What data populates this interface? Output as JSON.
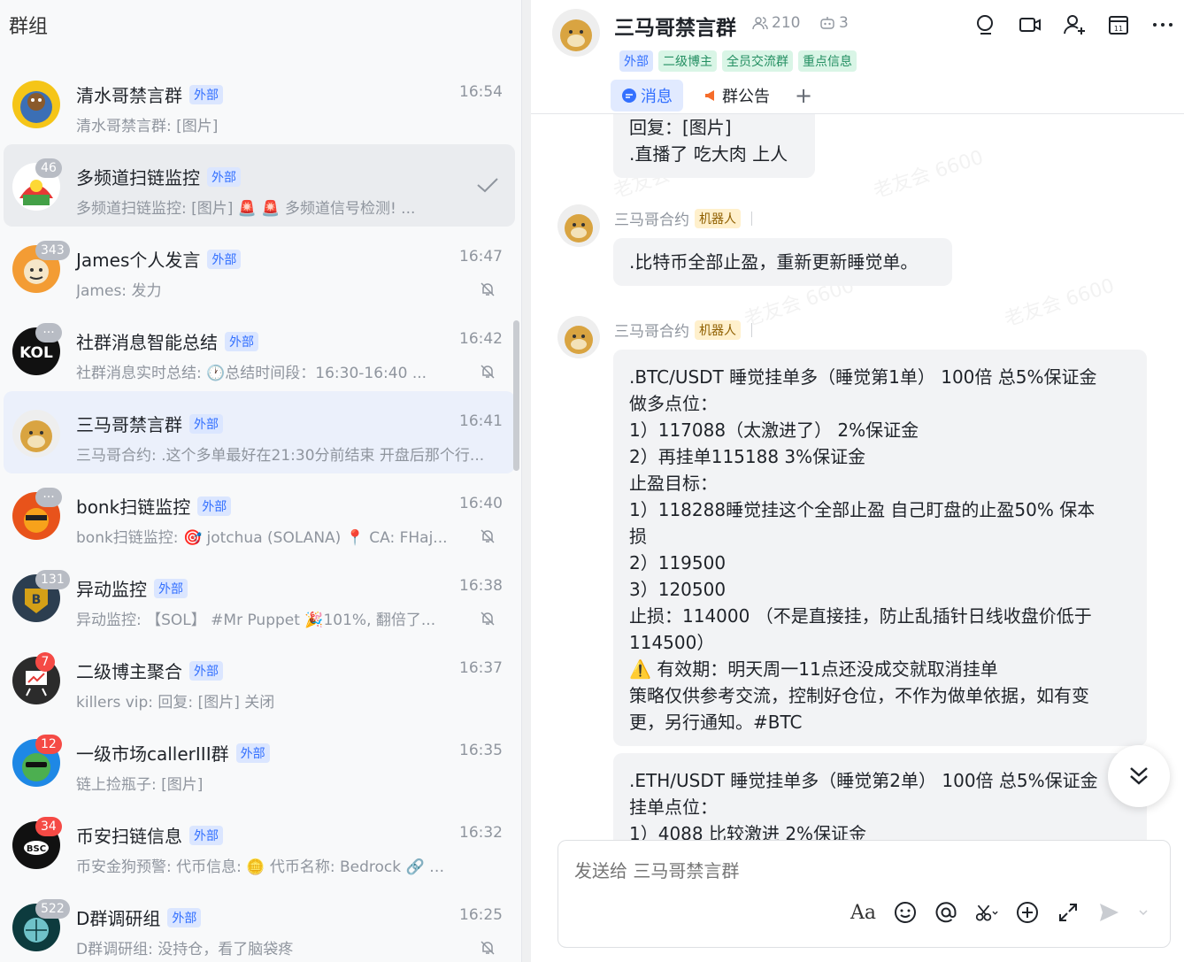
{
  "left": {
    "title": "群组",
    "chats": [
      {
        "name": "清水哥禁言群",
        "tag": "外部",
        "time": "16:54",
        "preview": "清水哥禁言群: [图片]",
        "badge": "",
        "muted": false
      },
      {
        "name": "多频道扫链监控",
        "tag": "外部",
        "time": "",
        "preview": "多频道扫链监控: [图片] 🚨 🚨 多频道信号检测! ...",
        "badge": "46",
        "muted": false
      },
      {
        "name": "James个人发言",
        "tag": "外部",
        "time": "16:47",
        "preview": "James: 发力",
        "badge": "343",
        "muted": true
      },
      {
        "name": "社群消息智能总结",
        "tag": "外部",
        "time": "16:42",
        "preview": "社群消息实时总结: 🕐总结时间段：16:30-16:40 ...",
        "badge": "···",
        "muted": true
      },
      {
        "name": "三马哥禁言群",
        "tag": "外部",
        "time": "16:41",
        "preview": "三马哥合约: .这个多单最好在21:30分前结束 开盘后那个行...",
        "badge": "",
        "muted": false
      },
      {
        "name": "bonk扫链监控",
        "tag": "外部",
        "time": "16:40",
        "preview": "bonk扫链监控: 🎯 jotchua (SOLANA) 📍 CA: FHaj...",
        "badge": "···",
        "muted": true
      },
      {
        "name": "异动监控",
        "tag": "外部",
        "time": "16:38",
        "preview": "异动监控: 【SOL】 #Mr Puppet 🎉101%, 翻倍了...",
        "badge": "131",
        "muted": true
      },
      {
        "name": "二级博主聚合",
        "tag": "外部",
        "time": "16:37",
        "preview": "killers vip: 回复: [图片] 关闭",
        "badge": "7",
        "muted": false
      },
      {
        "name": "一级市场callerIII群",
        "tag": "外部",
        "time": "16:35",
        "preview": "链上捡瓶子: [图片]",
        "badge": "12",
        "muted": false
      },
      {
        "name": "币安扫链信息",
        "tag": "外部",
        "time": "16:32",
        "preview": "币安金狗预警: 代币信息: 🪙 代币名称: Bedrock 🔗 代币C...",
        "badge": "34",
        "muted": false
      },
      {
        "name": "D群调研组",
        "tag": "外部",
        "time": "16:25",
        "preview": "D群调研组: 没持仓，看了脑袋疼",
        "badge": "522",
        "muted": true
      }
    ]
  },
  "header": {
    "title": "三马哥禁言群",
    "members": "210",
    "bots": "3",
    "tags": [
      "外部",
      "二级博主",
      "全员交流群",
      "重点信息"
    ],
    "tabs": [
      "消息",
      "群公告"
    ],
    "plus": "+"
  },
  "messages": {
    "reply_line1": "回复：[图片]",
    "reply_line2": ".直播了 吃大肉 上人",
    "sender1": "三马哥合约",
    "robot_tag": "机器人",
    "msg1": ".比特币全部止盈，重新更新睡觉单。",
    "sender2": "三马哥合约",
    "btc_lines": [
      ".BTC/USDT 睡觉挂单多（睡觉第1单） 100倍 总5%保证金",
      "做多点位：",
      "1）117088（太激进了） 2%保证金",
      "2）再挂单115188   3%保证金",
      "止盈目标：",
      "1）118288睡觉挂这个全部止盈  自己盯盘的止盈50% 保本",
      "损",
      "2）119500",
      "3）120500",
      "止损：114000 （不是直接挂，防止乱插针日线收盘价低于",
      "114500）",
      "⚠️ 有效期：明天周一11点还没成交就取消挂单",
      "策略仅供参考交流，控制好仓位，不作为做单依据，如有变",
      "更，另行通知。#BTC"
    ],
    "eth_lines": [
      ".ETH/USDT  睡觉挂单多（睡觉第2单） 100倍 总5%保证金",
      "挂单点位：",
      "1）4088 比较激进 2%保证金"
    ],
    "watermark": "老友会 6600"
  },
  "composer": {
    "placeholder": "发送给 三马哥禁言群",
    "font_tool": "Aa"
  },
  "colors": {
    "accent": "#3370ff",
    "selected_bg": "#ebf0fb",
    "bubble_bg": "#f2f3f5",
    "badge_red": "#f54a45"
  }
}
